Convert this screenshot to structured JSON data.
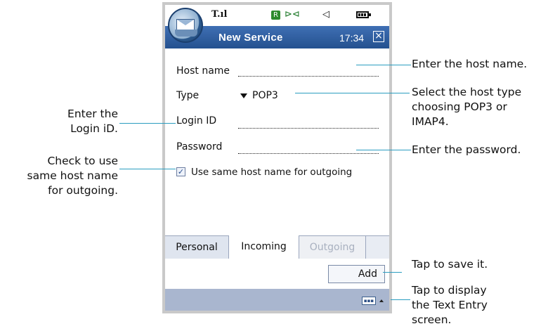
{
  "status_bar": {
    "signal": "T.ıl",
    "r_badge": "R",
    "bluetooth": "⊳⊲",
    "volume": "◁"
  },
  "title_bar": {
    "title": "New Service",
    "time": "17:34",
    "close": "×"
  },
  "form": {
    "host_name_label": "Host name",
    "type_label": "Type",
    "type_value": "POP3",
    "login_id_label": "Login ID",
    "password_label": "Password",
    "checkbox_checked": true,
    "checkbox_mark": "✓",
    "checkbox_label": "Use same host name for outgoing"
  },
  "tabs": {
    "items": [
      {
        "label": "Personal",
        "state": "inactive"
      },
      {
        "label": "Incoming",
        "state": "active"
      },
      {
        "label": "Outgoing",
        "state": "disabled"
      }
    ]
  },
  "add_button_label": "Add",
  "bottom_bar": {
    "keyboard_icon": "keyboard-icon"
  },
  "annotations": {
    "host_name": [
      "Enter the host name."
    ],
    "host_type": [
      "Select the host type",
      "choosing POP3 or",
      "IMAP4."
    ],
    "login_id": [
      "Enter the",
      "Login iD."
    ],
    "same_host": [
      "Check to use",
      "same host name",
      "for outgoing."
    ],
    "password": [
      "Enter the password."
    ],
    "save": [
      "Tap to save it."
    ],
    "text_entry": [
      "Tap to display",
      "the Text Entry",
      "screen."
    ]
  }
}
